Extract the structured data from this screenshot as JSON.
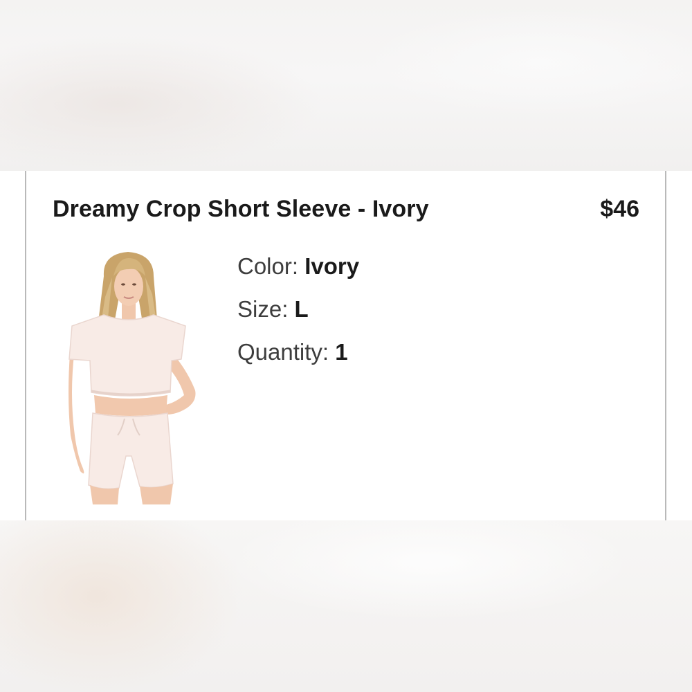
{
  "product": {
    "title": "Dreamy Crop Short Sleeve - Ivory",
    "price": "$46",
    "image_alt": "model wearing ivory crop top and shorts"
  },
  "attributes": {
    "color_label": "Color:",
    "color_value": "Ivory",
    "size_label": "Size:",
    "size_value": "L",
    "quantity_label": "Quantity:",
    "quantity_value": "1"
  },
  "colors": {
    "card_bg": "#ffffff",
    "border": "#b9b9b9",
    "text_primary": "#1a1a1a",
    "text_secondary": "#3d3d3d",
    "garment": "#f6e7e1"
  }
}
